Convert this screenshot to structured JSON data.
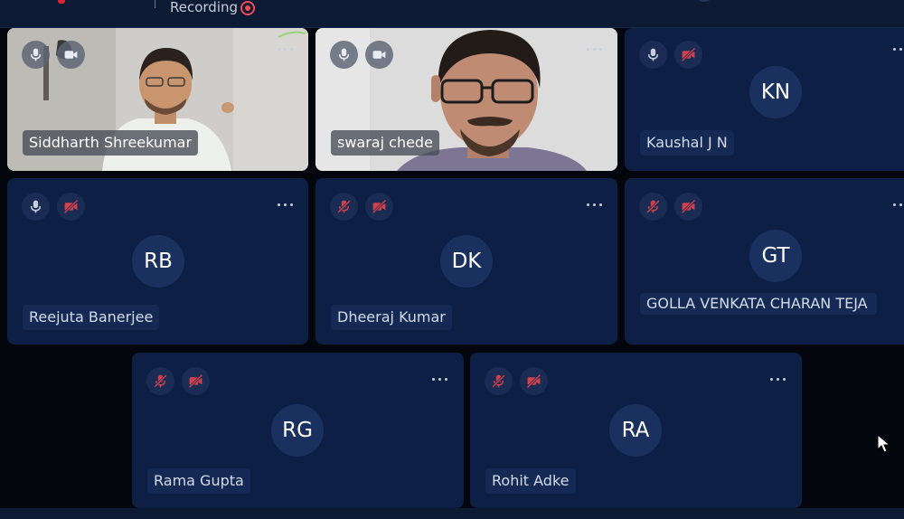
{
  "header": {
    "recording_label": "Recording"
  },
  "participants": [
    {
      "name": "Siddharth Shreekumar",
      "initials": "",
      "video": true,
      "mic": "on",
      "camera": "on"
    },
    {
      "name": "swaraj chede",
      "initials": "",
      "video": true,
      "mic": "on",
      "camera": "on"
    },
    {
      "name": "Kaushal J N",
      "initials": "KN",
      "video": false,
      "mic": "on",
      "camera": "off"
    },
    {
      "name": "Reejuta Banerjee",
      "initials": "RB",
      "video": false,
      "mic": "on",
      "camera": "off"
    },
    {
      "name": "Dheeraj Kumar",
      "initials": "DK",
      "video": false,
      "mic": "off",
      "camera": "off"
    },
    {
      "name": "GOLLA VENKATA CHARAN TEJA",
      "initials": "GT",
      "video": false,
      "mic": "off",
      "camera": "off"
    },
    {
      "name": "Rama Gupta",
      "initials": "RG",
      "video": false,
      "mic": "off",
      "camera": "off"
    },
    {
      "name": "Rohit Adke",
      "initials": "RA",
      "video": false,
      "mic": "off",
      "camera": "off"
    }
  ],
  "colors": {
    "background": "#03060d",
    "tile": "#0d1f45",
    "avatar": "#1a3160",
    "muted_icon": "#d0414c",
    "recording": "#ef4a55"
  }
}
